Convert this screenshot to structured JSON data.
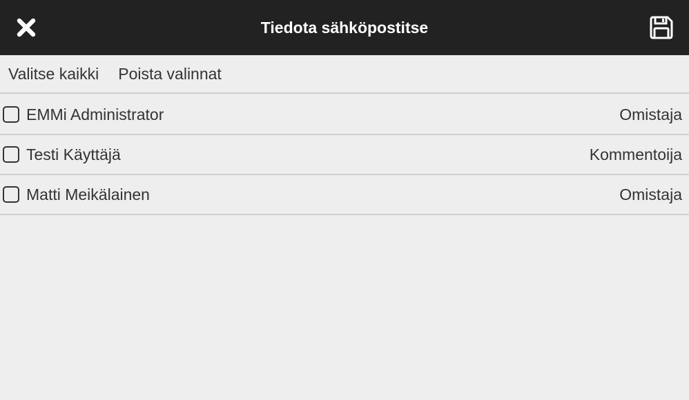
{
  "header": {
    "title": "Tiedota sähköpostitse",
    "close_icon": "close-icon",
    "save_icon": "save-icon"
  },
  "actions": {
    "select_all": "Valitse kaikki",
    "clear_selection": "Poista valinnat"
  },
  "recipients": [
    {
      "name": "EMMi Administrator",
      "role": "Omistaja",
      "checked": false
    },
    {
      "name": "Testi Käyttäjä",
      "role": "Kommentoija",
      "checked": false
    },
    {
      "name": "Matti Meikälainen",
      "role": "Omistaja",
      "checked": false
    }
  ],
  "colors": {
    "header_bg": "#222222",
    "page_bg": "#eeeeee",
    "text": "#333333",
    "divider": "#cfcfcf"
  }
}
